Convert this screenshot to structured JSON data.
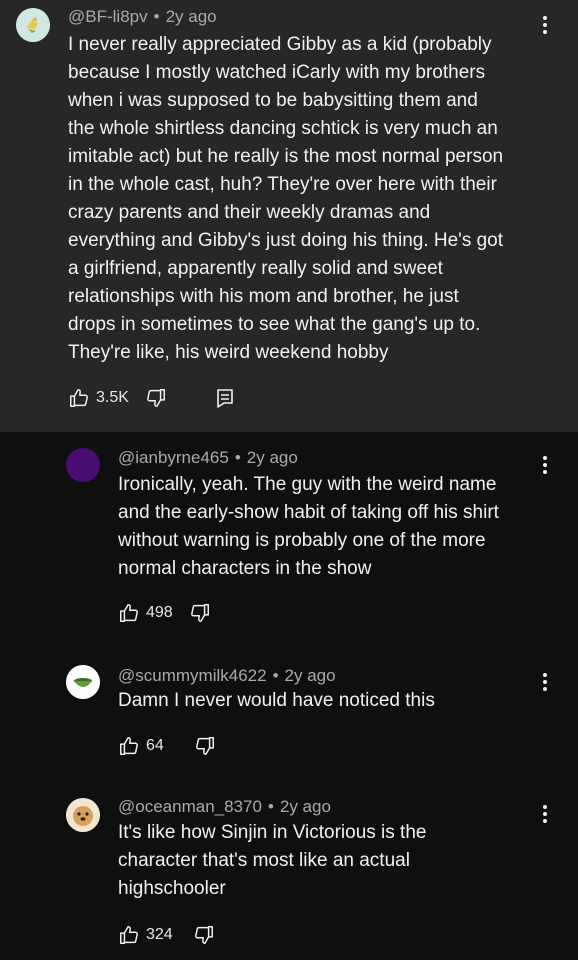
{
  "comments": [
    {
      "author": "@BF-li8pv",
      "age": "2y ago",
      "text": "I never really appreciated Gibby as a kid (probably\nbecause I mostly watched iCarly with my brothers\nwhen i was supposed to be babysitting them and\nthe whole shirtless dancing schtick is very much an\nimitable act) but he really is the most normal person\nin the whole cast, huh? They're over here with their\ncrazy parents and their weekly dramas and\neverything and Gibby's just doing his thing. He's got\na girlfriend, apparently really solid and sweet\nrelationships with his mom and brother, he just\ndrops in sometimes to see what the gang's up to.\nThey're like, his weird weekend hobby",
      "likes": "3.5K",
      "avatar_color": "#cfe9e2"
    },
    {
      "author": "@ianbyrne465",
      "age": "2y ago",
      "text": "Ironically, yeah. The guy with the weird name\nand the early-show habit of taking off his shirt\nwithout warning is probably one of the more\nnormal characters in the show",
      "likes": "498",
      "avatar_color": "#4a0e73"
    },
    {
      "author": "@scummymilk4622",
      "age": "2y ago",
      "text": "Damn I never would have noticed this",
      "likes": "64",
      "avatar_color": "#ffffff"
    },
    {
      "author": "@oceanman_8370",
      "age": "2y ago",
      "text": "It's like how Sinjin in Victorious is the\ncharacter that's most like an actual\nhighschooler",
      "likes": "324",
      "avatar_color": "#e8d2b0"
    }
  ],
  "icons": {
    "like": "thumbs-up-icon",
    "dislike": "thumbs-down-icon",
    "replies": "reply-icon",
    "more": "more-vertical-icon"
  }
}
